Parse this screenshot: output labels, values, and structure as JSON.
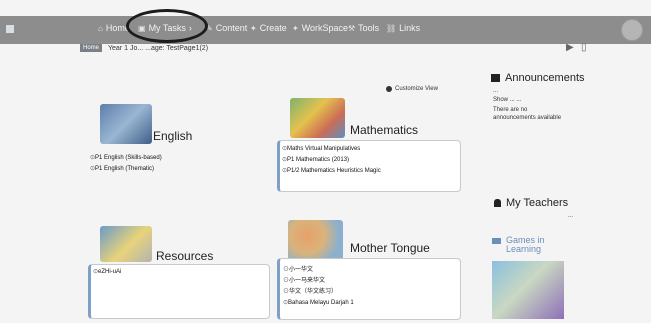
{
  "nav": {
    "items": [
      {
        "label": "Home",
        "icon": "home-icon"
      },
      {
        "label": "My Tasks",
        "icon": "tasks-icon"
      },
      {
        "label": "Content",
        "icon": "content-icon"
      },
      {
        "label": "Create",
        "icon": "create-icon"
      },
      {
        "label": "WorkSpace",
        "icon": "workspace-icon"
      },
      {
        "label": "Tools",
        "icon": "tools-icon"
      },
      {
        "label": "Links",
        "icon": "links-icon"
      }
    ],
    "my_tasks_arrow": "›"
  },
  "breadcrumb": {
    "home": "Home",
    "text": "Year 1 Jo... ...age: TestPage1(2)"
  },
  "customize": "Customize View",
  "subjects": [
    {
      "title": "English",
      "links": [
        "P1 English (Skills-based)",
        "P1 English (Thematic)"
      ]
    },
    {
      "title": "Mathematics",
      "links": [
        "Maths Virtual Manipulatives",
        "P1 Mathematics (2013)",
        "P1/2 Mathematics Heuristics Magic"
      ]
    },
    {
      "title": "Resources",
      "links": [
        "eZHi-uAi"
      ]
    },
    {
      "title": "Mother Tongue",
      "links": [
        "小一华文",
        "小一马来华文",
        "华文（华文练习）",
        "Bahasa Melayu Darjah 1"
      ]
    }
  ],
  "sidebar": {
    "announcements": {
      "title": "Announcements",
      "lines": [
        "...",
        "Show ... ...",
        "There are no",
        "announcements available"
      ]
    },
    "my_teachers": {
      "title": "My Teachers",
      "more": "..."
    },
    "games": {
      "title": "Games in Learning"
    }
  },
  "colors": {
    "topbar": "#8d8d8d",
    "accent": "#6a8fbb",
    "card_border": "#7ea0c4"
  }
}
